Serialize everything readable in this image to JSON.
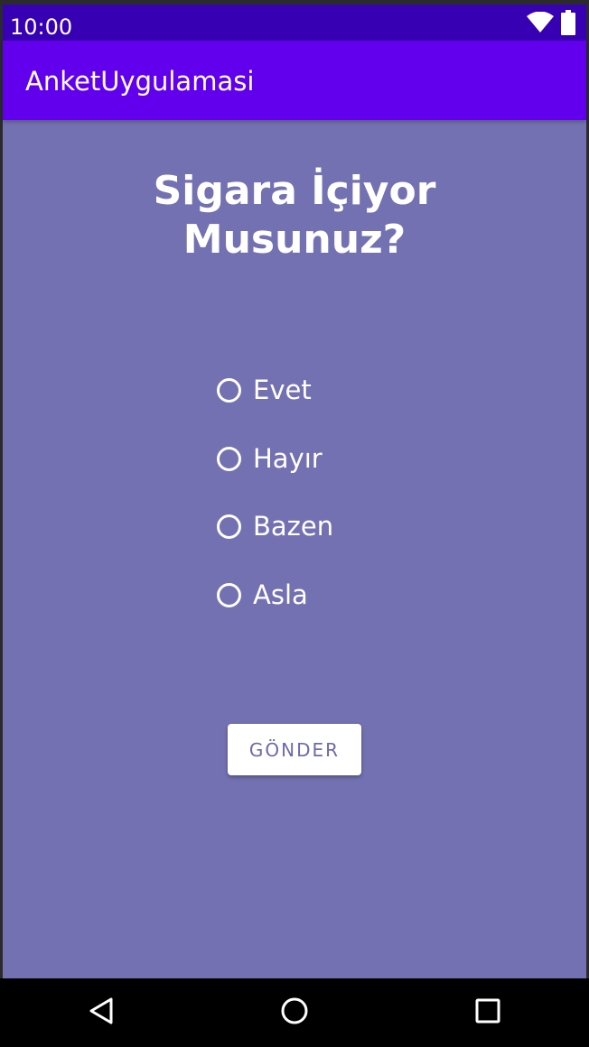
{
  "status_bar": {
    "time": "10:00",
    "icons": [
      "wifi-icon",
      "battery-icon"
    ]
  },
  "app_bar": {
    "title": "AnketUygulamasi"
  },
  "survey": {
    "question_line1": "Sigara İçiyor",
    "question_line2": "Musunuz?",
    "options": [
      {
        "label": "Evet",
        "selected": false
      },
      {
        "label": "Hayır",
        "selected": false
      },
      {
        "label": "Bazen",
        "selected": false
      },
      {
        "label": "Asla",
        "selected": false
      }
    ],
    "submit_label": "GÖNDER"
  },
  "nav_bar": {
    "buttons": [
      "back-icon",
      "home-icon",
      "recents-icon"
    ]
  },
  "colors": {
    "status_bar": "#3700b3",
    "app_bar": "#6200ee",
    "background": "#7371b1",
    "button_text": "#6d6aa9"
  }
}
